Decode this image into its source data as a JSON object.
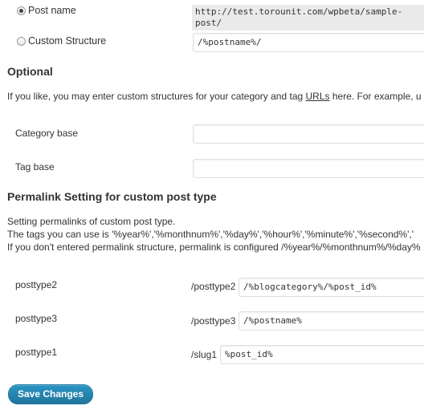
{
  "permalink_options": {
    "post_name_label": "Post name",
    "post_name_example": "http://test.torounit.com/wpbeta/sample-post/",
    "custom_structure_label": "Custom Structure",
    "custom_structure_value": "/%postname%/"
  },
  "optional": {
    "heading": "Optional",
    "description_prefix": "If you like, you may enter custom structures for your category and tag ",
    "description_urls": "URLs",
    "description_suffix": " here. For example, u",
    "category_base_label": "Category base",
    "category_base_value": "",
    "tag_base_label": "Tag base",
    "tag_base_value": ""
  },
  "custom_post_type": {
    "heading": "Permalink Setting for custom post type",
    "line1": "Setting permalinks of custom post type.",
    "line2": "The tags you can use is '%year%','%monthnum%','%day%','%hour%','%minute%','%second%','",
    "line3": "If you don't entered permalink structure, permalink is configured /%year%/%monthnum%/%day%",
    "rows": [
      {
        "label": "posttype2",
        "prefix": "/posttype2",
        "value": "/%blogcategory%/%post_id%"
      },
      {
        "label": "posttype3",
        "prefix": "/posttype3",
        "value": "/%postname%"
      },
      {
        "label": "posttype1",
        "prefix": "/slug1",
        "value": "%post_id%"
      }
    ]
  },
  "save_button_label": "Save Changes",
  "colors": {
    "primary_button": "#21759b",
    "text": "#333333",
    "code_background": "#eaeaea"
  }
}
